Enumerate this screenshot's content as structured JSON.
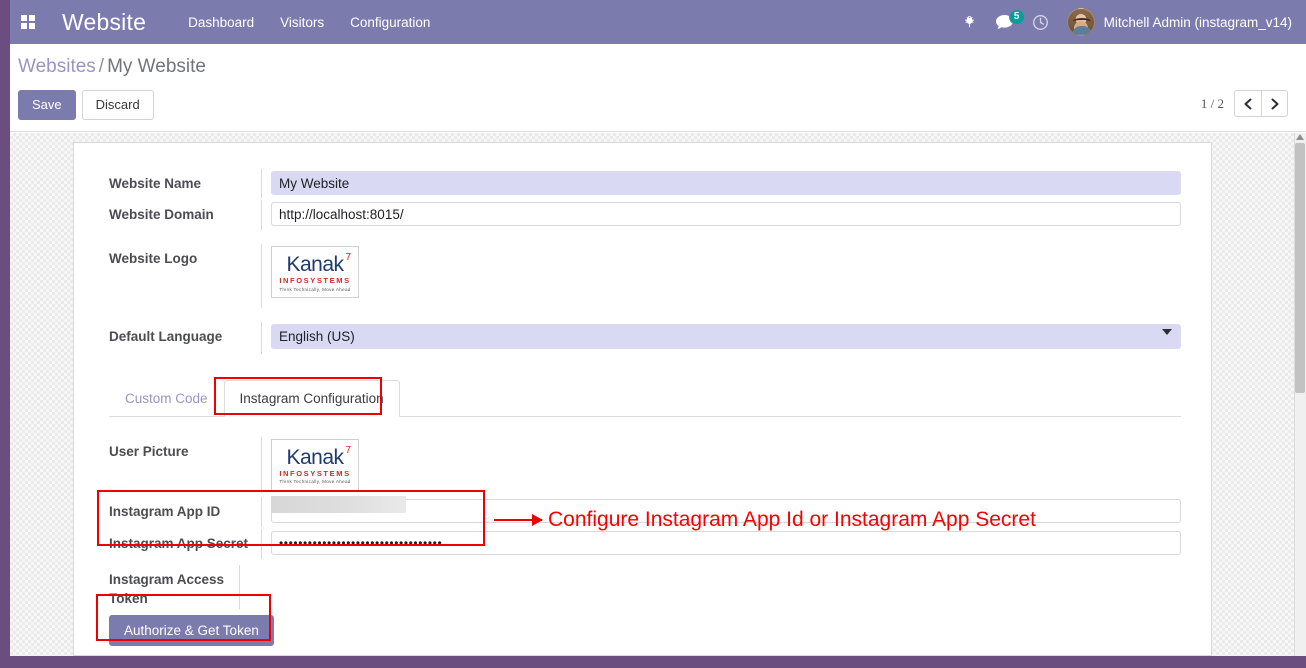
{
  "navbar": {
    "apps_icon": "apps-grid-icon",
    "brand": "Website",
    "menu": [
      {
        "label": "Dashboard"
      },
      {
        "label": "Visitors"
      },
      {
        "label": "Configuration"
      }
    ],
    "bug_icon": "bug-icon",
    "messages_icon": "chat-bubble-icon",
    "messages_count": "5",
    "activity_icon": "clock-icon",
    "user_name": "Mitchell Admin (instagram_v14)",
    "avatar": "user-avatar",
    "bg_color": "#7c7bad",
    "badge_color": "#00a09d"
  },
  "control_panel": {
    "breadcrumb_root": "Websites",
    "breadcrumb_sep": "/",
    "breadcrumb_current": "My Website",
    "save_label": "Save",
    "discard_label": "Discard",
    "pager_count": "1 / 2",
    "prev_icon": "chevron-left-icon",
    "next_icon": "chevron-right-icon"
  },
  "form": {
    "website_name": {
      "label": "Website Name",
      "value": "My Website"
    },
    "website_domain": {
      "label": "Website Domain",
      "value": "http://localhost:8015/"
    },
    "website_logo": {
      "label": "Website Logo"
    },
    "default_language": {
      "label": "Default Language",
      "value": "English (US)",
      "options": [
        "English (US)"
      ]
    }
  },
  "logo": {
    "main": "Kanak",
    "flag": "7",
    "sub": "INFOSYSTEMS",
    "tagline": "Think Technically, Move Ahead",
    "main_color": "#1f3a6e",
    "accent_color": "#d32a20"
  },
  "notebook": {
    "tabs": [
      {
        "label": "Custom Code",
        "active": false
      },
      {
        "label": "Instagram Configuration",
        "active": true
      }
    ]
  },
  "instagram": {
    "user_picture": {
      "label": "User Picture"
    },
    "app_id": {
      "label": "Instagram App ID",
      "value": ""
    },
    "app_secret": {
      "label": "Instagram App Secret",
      "value": "••••••••••••••••••••••••••••••••••"
    },
    "access_token": {
      "label": "Instagram Access Token",
      "value": ""
    },
    "authorize_button": "Authorize & Get Token"
  },
  "annotations": {
    "callout_text": "Configure Instagram App Id or Instagram App Secret",
    "color": "#ee0000"
  }
}
